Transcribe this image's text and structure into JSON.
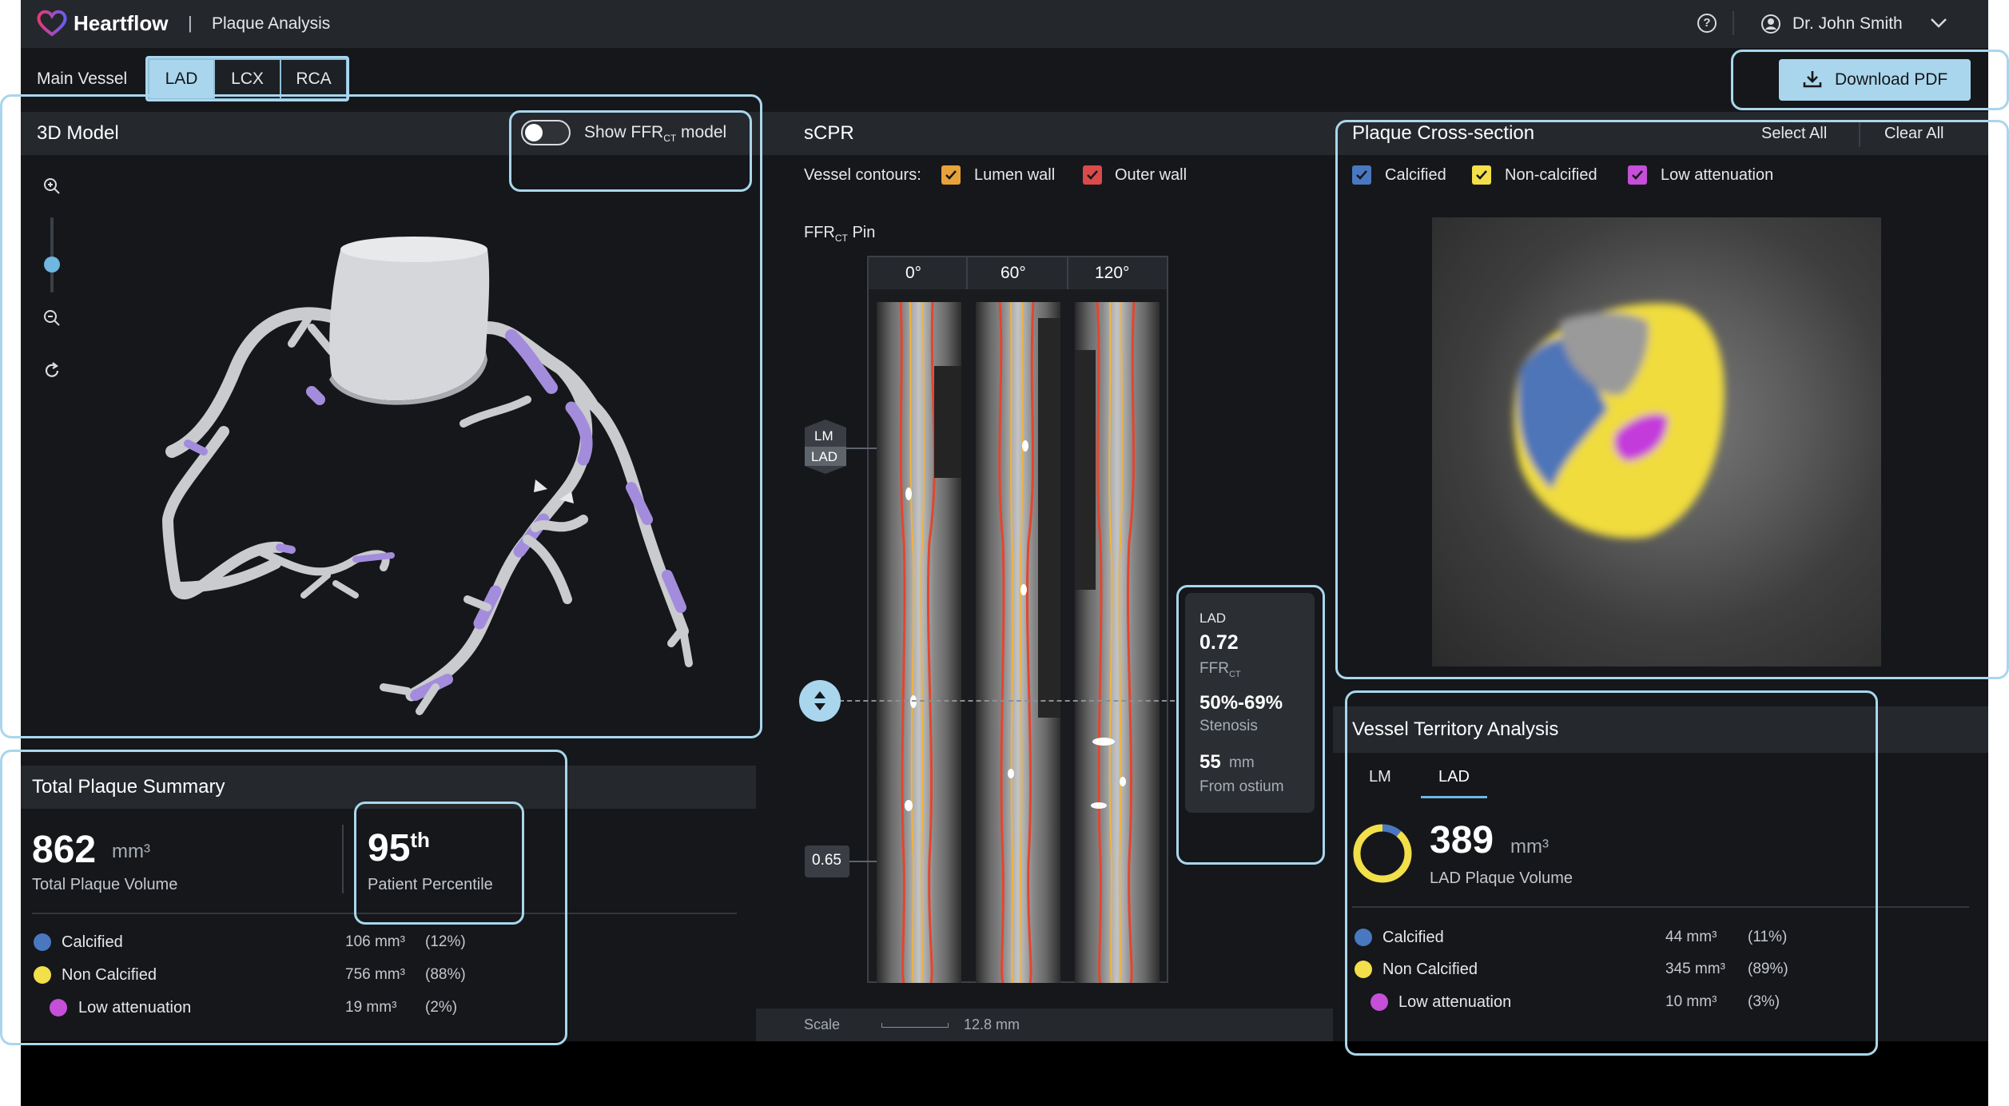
{
  "app": {
    "brand": "Heartflow",
    "separator": "|",
    "title": "Plaque Analysis"
  },
  "header": {
    "help_icon": "help-circle-icon",
    "user_name": "Dr. John Smith"
  },
  "vessel_selector": {
    "label": "Main Vessel",
    "tabs": [
      "LAD",
      "LCX",
      "RCA"
    ],
    "selected": "LAD"
  },
  "download": {
    "label": "Download PDF"
  },
  "model3d": {
    "title": "3D Model",
    "toggle_label": "Show FFR",
    "toggle_sub": "CT",
    "toggle_suffix": " model",
    "toggle_on": false
  },
  "scpr": {
    "title": "sCPR",
    "contours_label": "Vessel contours:",
    "lumen_label": "Lumen wall",
    "outer_label": "Outer wall",
    "pin_label": "FFR",
    "pin_sub": "CT",
    "pin_suffix": " Pin",
    "angles": [
      "0°",
      "60°",
      "120°"
    ],
    "marker_top": "LM",
    "marker_bottom": "LAD",
    "value_marker": "0.65",
    "scale_label": "Scale",
    "scale_value": "12.8 mm"
  },
  "tooltip": {
    "vessel": "LAD",
    "ffr_value": "0.72",
    "ffr_label": "FFR",
    "ffr_sub": "CT",
    "stenosis_value": "50%-69%",
    "stenosis_label": "Stenosis",
    "distance_value": "55",
    "distance_unit": "mm",
    "distance_label": "From ostium"
  },
  "cross_section": {
    "title": "Plaque Cross-section",
    "select_all": "Select All",
    "clear_all": "Clear All",
    "filters": [
      {
        "label": "Calcified",
        "color": "#4a78c0"
      },
      {
        "label": "Non-calcified",
        "color": "#f2df4a"
      },
      {
        "label": "Low attenuation",
        "color": "#c54fd8"
      }
    ]
  },
  "summary": {
    "title": "Total Plaque Summary",
    "volume_value": "862",
    "volume_unit": "mm³",
    "volume_label": "Total Plaque Volume",
    "percentile_value": "95",
    "percentile_suffix": "th",
    "percentile_label": "Patient Percentile",
    "rows": [
      {
        "label": "Calcified",
        "value": "106 mm³",
        "pct": "(12%)",
        "color": "#4a78c0"
      },
      {
        "label": "Non Calcified",
        "value": "756 mm³",
        "pct": "(88%)",
        "color": "#f2df4a"
      },
      {
        "label": "Low attenuation",
        "value": "19 mm³",
        "pct": "(2%)",
        "color": "#c54fd8"
      }
    ]
  },
  "territory": {
    "title": "Vessel Territory Analysis",
    "tabs": [
      "LM",
      "LAD"
    ],
    "selected": "LAD",
    "volume_value": "389",
    "volume_unit": "mm³",
    "volume_label": "LAD Plaque Volume",
    "donut_shares": {
      "calcified": 0.11,
      "non_calcified": 0.89
    },
    "rows": [
      {
        "label": "Calcified",
        "value": "44 mm³",
        "pct": "(11%)",
        "color": "#4a78c0"
      },
      {
        "label": "Non Calcified",
        "value": "345 mm³",
        "pct": "(89%)",
        "color": "#f2df4a"
      },
      {
        "label": "Low attenuation",
        "value": "10 mm³",
        "pct": "(3%)",
        "color": "#c54fd8"
      }
    ]
  }
}
